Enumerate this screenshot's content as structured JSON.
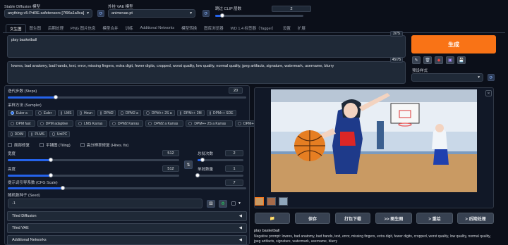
{
  "top": {
    "model_label": "Stable Diffusion 模型",
    "model_value": "anything-v5-PrtRE.safetensors [7f96a1a9ca]",
    "vae_label": "外挂 VAE 模型",
    "vae_value": "animevae.pt",
    "clip_label": "跳过 CLIP 层数",
    "clip_value": "2",
    "clip_fraction": 0.08
  },
  "tabs": [
    "文生图",
    "图生图",
    "后期处理",
    "PNG 图片信息",
    "模型合并",
    "训练",
    "Additional Networks",
    "模型转换",
    "图库浏览器",
    "WD 1.4 标签器（Tagger）",
    "设置",
    "扩展"
  ],
  "prompt": {
    "positive": "play basketball",
    "positive_count": "2/75",
    "negative": "lowres, bad anatomy, bad hands, text, error, missing fingers, extra digit, fewer digits, cropped, worst quality, low quality, normal quality, jpeg artifacts, signature, watermark, username, blurry",
    "negative_count": "45/75"
  },
  "generate": {
    "label": "生成",
    "style_label": "预设样式"
  },
  "tool_icons": [
    "✎",
    "🗑",
    "◆",
    "▣",
    "💾"
  ],
  "steps": {
    "label": "迭代步数 (Steps)",
    "value": "20",
    "fraction": 0.2
  },
  "sampler": {
    "label": "采样方法 (Sampler)",
    "options": [
      "Euler a",
      "Euler",
      "LMS",
      "Heun",
      "DPM2",
      "DPM2 a",
      "DPM++ 2S a",
      "DPM++ 2M",
      "DPM++ SDE",
      "DPM fast",
      "DPM adaptive",
      "LMS Karras",
      "DPM2 Karras",
      "DPM2 a Karras",
      "DPM++ 2S a Karras",
      "DPM++ 2M Karras",
      "DPM++ SDE Karras",
      "DDIM",
      "PLMS",
      "UniPC"
    ],
    "selected": "Euler a"
  },
  "checks": [
    "面部修复",
    "平铺图 (Tiling)",
    "高分辨率修复 (Hires. fix)"
  ],
  "width": {
    "label": "宽度",
    "value": "512",
    "fraction": 0.25
  },
  "height": {
    "label": "高度",
    "value": "512",
    "fraction": 0.25
  },
  "batch_count": {
    "label": "总批次数",
    "value": "2",
    "fraction": 0.1
  },
  "batch_size": {
    "label": "单批数量",
    "value": "1",
    "fraction": 0.0
  },
  "cfg": {
    "label": "提示词引导系数 (CFG Scale)",
    "value": "7",
    "fraction": 0.23
  },
  "seed": {
    "label": "随机数种子 (Seed)",
    "value": "-1"
  },
  "accordions": [
    "Tiled Diffusion",
    "Tiled VAE",
    "Additional Networks"
  ],
  "gallery_buttons": [
    "📁",
    "保存",
    "打包下载",
    ">> 图生图",
    "> 重绘",
    "> 后期处理"
  ],
  "info": {
    "title": "play basketball",
    "negative": "Negative prompt: lowres, bad anatomy, bad hands, text, error, missing fingers, extra digit, fewer digits, cropped, worst quality, low quality, normal quality, jpeg artifacts, signature, watermark, username, blurry"
  },
  "colors": {
    "accent": "#f97316",
    "slider": "#2563eb",
    "bg": "#0b0f19"
  }
}
